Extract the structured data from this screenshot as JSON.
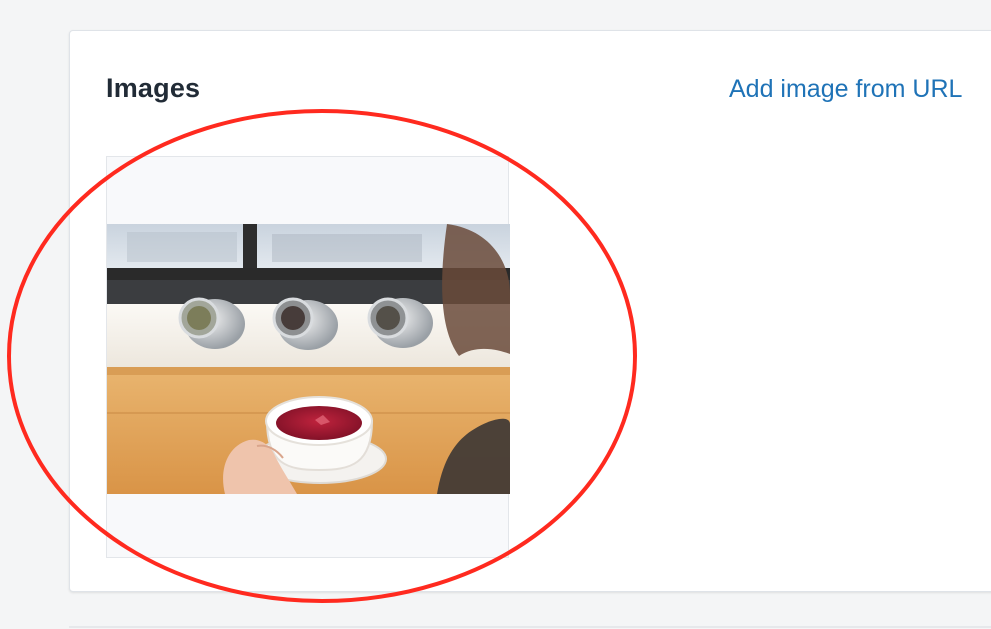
{
  "images_section": {
    "title": "Images",
    "add_link_label": "Add image from URL",
    "link_color": "#1f73b7"
  },
  "thumbnail": {
    "subject": "tea-photo"
  },
  "annotation": {
    "shape": "ellipse",
    "color": "#ff2a1f"
  }
}
